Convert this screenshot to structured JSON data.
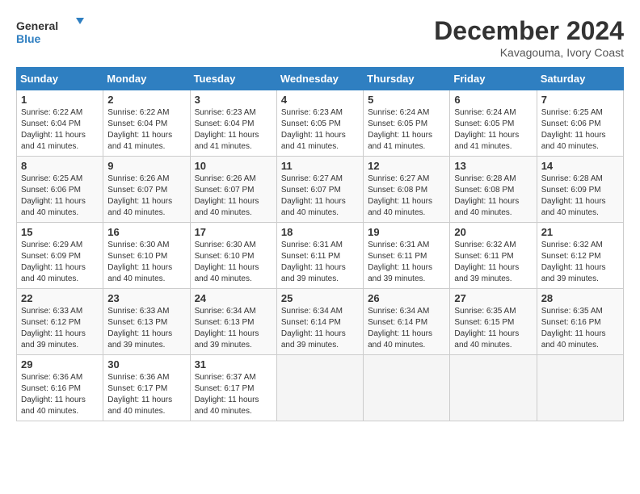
{
  "logo": {
    "text_general": "General",
    "text_blue": "Blue"
  },
  "title": "December 2024",
  "location": "Kavagouma, Ivory Coast",
  "days_of_week": [
    "Sunday",
    "Monday",
    "Tuesday",
    "Wednesday",
    "Thursday",
    "Friday",
    "Saturday"
  ],
  "weeks": [
    [
      {
        "day": "1",
        "sunrise": "6:22 AM",
        "sunset": "6:04 PM",
        "daylight": "11 hours and 41 minutes."
      },
      {
        "day": "2",
        "sunrise": "6:22 AM",
        "sunset": "6:04 PM",
        "daylight": "11 hours and 41 minutes."
      },
      {
        "day": "3",
        "sunrise": "6:23 AM",
        "sunset": "6:04 PM",
        "daylight": "11 hours and 41 minutes."
      },
      {
        "day": "4",
        "sunrise": "6:23 AM",
        "sunset": "6:05 PM",
        "daylight": "11 hours and 41 minutes."
      },
      {
        "day": "5",
        "sunrise": "6:24 AM",
        "sunset": "6:05 PM",
        "daylight": "11 hours and 41 minutes."
      },
      {
        "day": "6",
        "sunrise": "6:24 AM",
        "sunset": "6:05 PM",
        "daylight": "11 hours and 41 minutes."
      },
      {
        "day": "7",
        "sunrise": "6:25 AM",
        "sunset": "6:06 PM",
        "daylight": "11 hours and 40 minutes."
      }
    ],
    [
      {
        "day": "8",
        "sunrise": "6:25 AM",
        "sunset": "6:06 PM",
        "daylight": "11 hours and 40 minutes."
      },
      {
        "day": "9",
        "sunrise": "6:26 AM",
        "sunset": "6:07 PM",
        "daylight": "11 hours and 40 minutes."
      },
      {
        "day": "10",
        "sunrise": "6:26 AM",
        "sunset": "6:07 PM",
        "daylight": "11 hours and 40 minutes."
      },
      {
        "day": "11",
        "sunrise": "6:27 AM",
        "sunset": "6:07 PM",
        "daylight": "11 hours and 40 minutes."
      },
      {
        "day": "12",
        "sunrise": "6:27 AM",
        "sunset": "6:08 PM",
        "daylight": "11 hours and 40 minutes."
      },
      {
        "day": "13",
        "sunrise": "6:28 AM",
        "sunset": "6:08 PM",
        "daylight": "11 hours and 40 minutes."
      },
      {
        "day": "14",
        "sunrise": "6:28 AM",
        "sunset": "6:09 PM",
        "daylight": "11 hours and 40 minutes."
      }
    ],
    [
      {
        "day": "15",
        "sunrise": "6:29 AM",
        "sunset": "6:09 PM",
        "daylight": "11 hours and 40 minutes."
      },
      {
        "day": "16",
        "sunrise": "6:30 AM",
        "sunset": "6:10 PM",
        "daylight": "11 hours and 40 minutes."
      },
      {
        "day": "17",
        "sunrise": "6:30 AM",
        "sunset": "6:10 PM",
        "daylight": "11 hours and 40 minutes."
      },
      {
        "day": "18",
        "sunrise": "6:31 AM",
        "sunset": "6:11 PM",
        "daylight": "11 hours and 39 minutes."
      },
      {
        "day": "19",
        "sunrise": "6:31 AM",
        "sunset": "6:11 PM",
        "daylight": "11 hours and 39 minutes."
      },
      {
        "day": "20",
        "sunrise": "6:32 AM",
        "sunset": "6:11 PM",
        "daylight": "11 hours and 39 minutes."
      },
      {
        "day": "21",
        "sunrise": "6:32 AM",
        "sunset": "6:12 PM",
        "daylight": "11 hours and 39 minutes."
      }
    ],
    [
      {
        "day": "22",
        "sunrise": "6:33 AM",
        "sunset": "6:12 PM",
        "daylight": "11 hours and 39 minutes."
      },
      {
        "day": "23",
        "sunrise": "6:33 AM",
        "sunset": "6:13 PM",
        "daylight": "11 hours and 39 minutes."
      },
      {
        "day": "24",
        "sunrise": "6:34 AM",
        "sunset": "6:13 PM",
        "daylight": "11 hours and 39 minutes."
      },
      {
        "day": "25",
        "sunrise": "6:34 AM",
        "sunset": "6:14 PM",
        "daylight": "11 hours and 39 minutes."
      },
      {
        "day": "26",
        "sunrise": "6:34 AM",
        "sunset": "6:14 PM",
        "daylight": "11 hours and 40 minutes."
      },
      {
        "day": "27",
        "sunrise": "6:35 AM",
        "sunset": "6:15 PM",
        "daylight": "11 hours and 40 minutes."
      },
      {
        "day": "28",
        "sunrise": "6:35 AM",
        "sunset": "6:16 PM",
        "daylight": "11 hours and 40 minutes."
      }
    ],
    [
      {
        "day": "29",
        "sunrise": "6:36 AM",
        "sunset": "6:16 PM",
        "daylight": "11 hours and 40 minutes."
      },
      {
        "day": "30",
        "sunrise": "6:36 AM",
        "sunset": "6:17 PM",
        "daylight": "11 hours and 40 minutes."
      },
      {
        "day": "31",
        "sunrise": "6:37 AM",
        "sunset": "6:17 PM",
        "daylight": "11 hours and 40 minutes."
      },
      null,
      null,
      null,
      null
    ]
  ],
  "labels": {
    "sunrise": "Sunrise:",
    "sunset": "Sunset:",
    "daylight": "Daylight:"
  }
}
